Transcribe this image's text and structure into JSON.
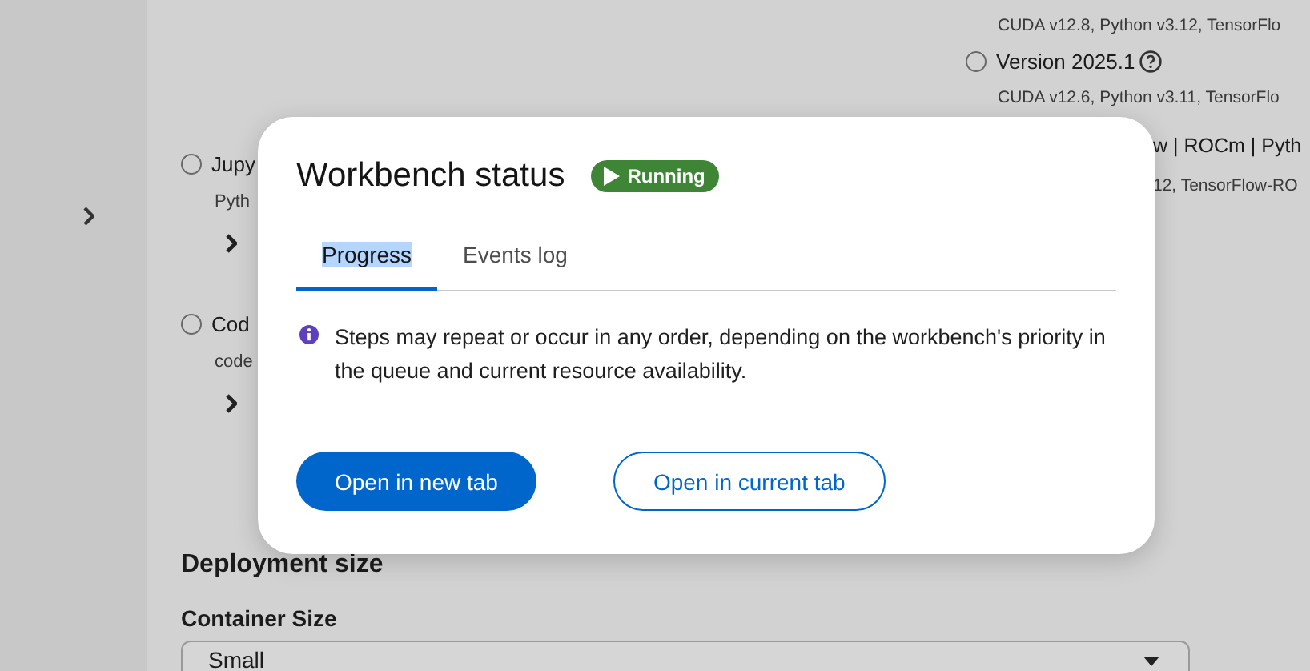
{
  "background": {
    "left_options": [
      {
        "label": "Jupy",
        "detail": "Pyth",
        "selected": false
      },
      {
        "label": "Cod",
        "detail": "code",
        "selected": false
      }
    ],
    "right_options": [
      {
        "detail_above": "CUDA v12.8, Python v3.12, TensorFlo",
        "label": "Version 2025.1",
        "selected": false,
        "detail": "CUDA v12.6, Python v3.11, TensorFlo"
      }
    ],
    "right_fragments": [
      "w | ROCm | Pyth",
      "12, TensorFlow-RO"
    ],
    "section_title": "Deployment size",
    "field_label": "Container Size",
    "select": {
      "value": "Small"
    }
  },
  "modal": {
    "title": "Workbench status",
    "status": "Running",
    "tabs": [
      {
        "label": "Progress",
        "selected": true
      },
      {
        "label": "Events log",
        "selected": false
      }
    ],
    "info": "Steps may repeat or occur in any order, depending on the workbench's priority in the queue and current resource availability.",
    "buttons": [
      {
        "label": "Open in new tab",
        "kind": "primary"
      },
      {
        "label": "Open in current tab",
        "kind": "secondary"
      }
    ]
  }
}
